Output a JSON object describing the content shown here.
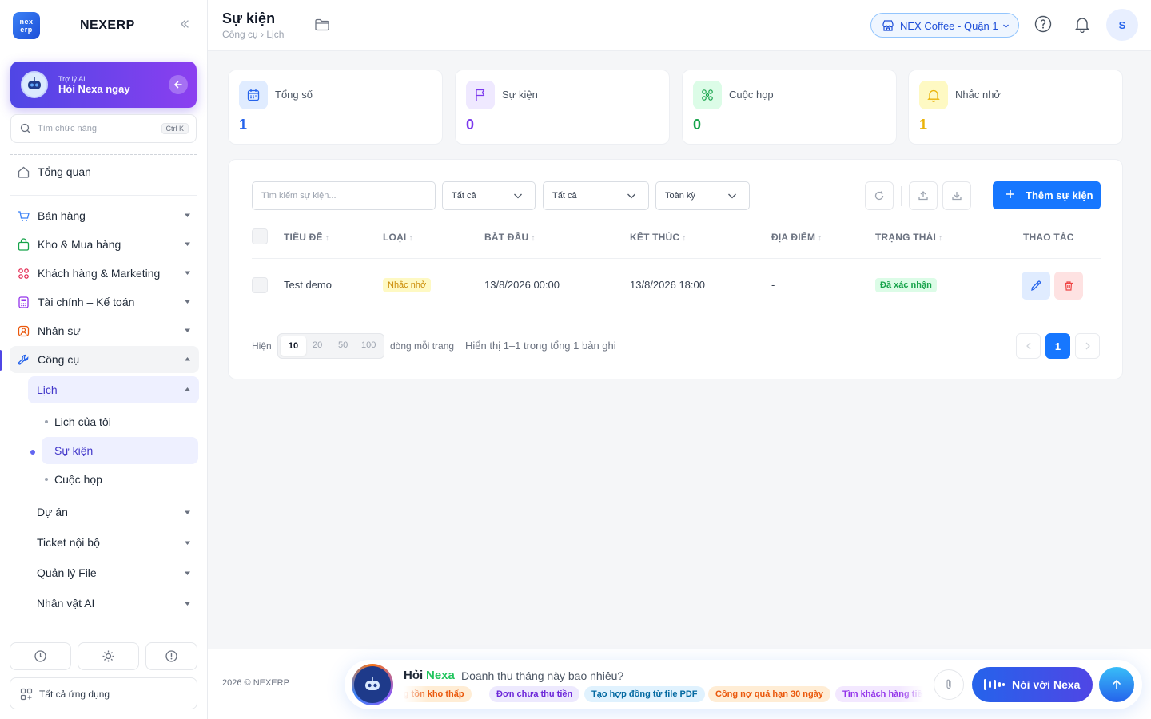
{
  "app": {
    "logo_text_1": "nex",
    "logo_text_2": "erp",
    "brand": "NEXERP"
  },
  "ai_card": {
    "small": "Trợ lý AI",
    "big": "Hỏi Nexa ngay"
  },
  "side_search": {
    "placeholder": "Tìm chức năng",
    "shortcut": "Ctrl K"
  },
  "nav": {
    "overview": "Tổng quan",
    "sales": "Bán hàng",
    "warehouse": "Kho & Mua hàng",
    "crm": "Khách hàng & Marketing",
    "finance": "Tài chính – Kế toán",
    "hr": "Nhân sự",
    "tools": "Công cụ",
    "calendar": "Lịch",
    "my_calendar": "Lịch của tôi",
    "events": "Sự kiện",
    "meetings": "Cuộc họp",
    "projects": "Dự án",
    "tickets": "Ticket nội bộ",
    "files": "Quản lý File",
    "ai_chars": "Nhân vật AI"
  },
  "side_footer": {
    "all_apps": "Tất cả ứng dụng"
  },
  "header": {
    "title": "Sự kiện",
    "breadcrumb": "Công cụ › Lịch",
    "store": "NEX Coffee - Quận 1",
    "avatar": "S"
  },
  "stats": [
    {
      "label": "Tổng số",
      "value": "1",
      "color": "#2563eb"
    },
    {
      "label": "Sự kiện",
      "value": "0",
      "color": "#7c3aed"
    },
    {
      "label": "Cuộc họp",
      "value": "0",
      "color": "#16a34a"
    },
    {
      "label": "Nhắc nhở",
      "value": "1",
      "color": "#eab308"
    }
  ],
  "filters": {
    "search_placeholder": "Tìm kiếm sự kiện...",
    "type": "Tất cả",
    "status": "Tất cả",
    "period": "Toàn kỳ",
    "add_button": "Thêm sự kiện"
  },
  "table": {
    "columns": [
      "TIÊU ĐỀ",
      "LOẠI",
      "BẮT ĐẦU",
      "KẾT THÚC",
      "ĐỊA ĐIỂM",
      "TRẠNG THÁI",
      "THAO TÁC"
    ],
    "rows": [
      {
        "title": "Test demo",
        "type": "Nhắc nhở",
        "start": "13/8/2026 00:00",
        "end": "13/8/2026 18:00",
        "location": "-",
        "status": "Đã xác nhận"
      }
    ]
  },
  "pagination": {
    "show": "Hiện",
    "sizes": [
      "10",
      "20",
      "50",
      "100"
    ],
    "per_page": "dòng mỗi trang",
    "summary": "Hiển thị 1–1 trong tổng 1 bản ghi",
    "current": "1"
  },
  "footer": {
    "copyright": "2026 © NEXERP",
    "ask_hoi": "Hỏi",
    "ask_nexa": "Nexa",
    "ask_question": "Doanh thu tháng này bao nhiêu?",
    "chips": [
      "Hàng tồn kho thấp",
      "Đơn chưa thu tiền",
      "Tạo hợp đồng từ file PDF",
      "Công nợ quá hạn 30 ngày",
      "Tìm khách hàng tiềm năng"
    ],
    "talk": "Nói với Nexa"
  }
}
